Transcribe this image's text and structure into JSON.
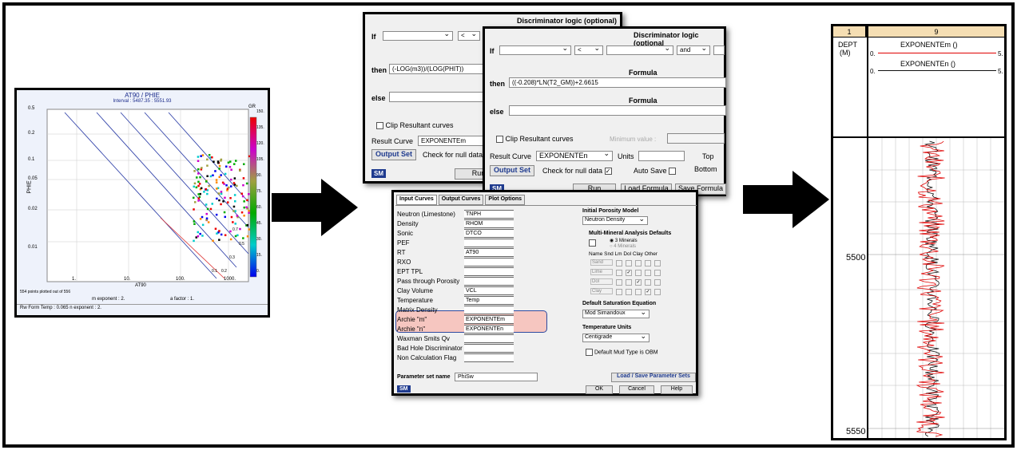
{
  "crossplot": {
    "title": "AT90 / PHIE",
    "interval": "Interval : 5487.35 : 5551.93",
    "y_label": "PHIE",
    "x_label": "AT90",
    "right_label": "GR",
    "y_ticks": [
      "0.5",
      "0.2",
      "0.1",
      "0.05",
      "0.02",
      "0.01"
    ],
    "x_ticks": [
      "1.",
      "10.",
      "100.",
      "1000."
    ],
    "color_ticks": [
      "150.",
      "135.",
      "120.",
      "105.",
      "90.",
      "75.",
      "60.",
      "45.",
      "30.",
      "15.",
      "0."
    ],
    "line_labels": [
      "0.1",
      "0.2",
      "0.3",
      "0.5",
      "0.7"
    ],
    "points_text": "554 points plotted out of 556",
    "m_exponent": "m exponent : 2.",
    "a_factor": "a factor : 1.",
    "footer": "Rw Form Temp : 0.065  n exponent : 2.",
    "chart_data": {
      "type": "scatter",
      "title": "AT90 / PHIE",
      "xlabel": "AT90",
      "ylabel": "PHIE",
      "x_scale": "log",
      "y_scale": "log",
      "xlim": [
        0.2,
        2000
      ],
      "ylim": [
        0.01,
        0.5
      ],
      "legend": "GR color scale, right"
    }
  },
  "disc1": {
    "title": "Discriminator logic (optional)",
    "if_label": "If",
    "op": "<",
    "then_label": "then",
    "then_formula": "(-LOG(m3))/(LOG(PHIT))",
    "else_label": "else",
    "clip_label": "Clip Resultant curves",
    "result_label": "Result Curve",
    "result_value": "EXPONENTEm",
    "output_set": "Output Set",
    "check_null": "Check for null data",
    "logo": "SM",
    "run": "Run"
  },
  "disc2": {
    "title": "Discriminator logic (optional",
    "if_label": "If",
    "op": "<",
    "and_label": "and",
    "formula_header": "Formula",
    "then_label": "then",
    "then_formula": "((-0.208)*LN(T2_GM))+2.6615",
    "formula_header2": "Formula",
    "else_label": "else",
    "clip_label": "Clip Resultant curves",
    "min_label": "Minimum value :",
    "result_label": "Result Curve",
    "result_value": "EXPONENTEn",
    "units_label": "Units",
    "top_label": "Top",
    "output_set": "Output Set",
    "check_null": "Check for null data",
    "auto_save": "Auto Save",
    "bottom_label": "Bottom",
    "logo": "SM",
    "run": "Run",
    "load_formula": "Load Formula",
    "save_formula": "Save Formula"
  },
  "params": {
    "tabs": [
      "Input Curves",
      "Output Curves",
      "Plot Options"
    ],
    "rows": [
      {
        "label": "Neutron (Limestone)",
        "value": "TNPH"
      },
      {
        "label": "Density",
        "value": "RHOM"
      },
      {
        "label": "Sonic",
        "value": "DTCO"
      },
      {
        "label": "PEF",
        "value": ""
      },
      {
        "label": "RT",
        "value": "AT90"
      },
      {
        "label": "RXO",
        "value": ""
      },
      {
        "label": "EPT TPL",
        "value": ""
      },
      {
        "label": "Pass through Porosity",
        "value": ""
      },
      {
        "label": "Clay Volume",
        "value": "VCL"
      },
      {
        "label": "Temperature",
        "value": "Temp"
      },
      {
        "label": "Matrix Density",
        "value": ""
      },
      {
        "label": "Archie \"m\"",
        "value": "EXPONENTEm"
      },
      {
        "label": "Archie \"n\"",
        "value": "EXPONENTEn"
      },
      {
        "label": "Waxman Smits Qv",
        "value": ""
      },
      {
        "label": "Bad Hole Discriminator",
        "value": ""
      },
      {
        "label": "Non Calculation Flag",
        "value": ""
      }
    ],
    "porosity_title": "Initial Porosity Model",
    "porosity_value": "Neutron Density",
    "mineral_title": "Multi-Mineral Analysis Defaults",
    "mineral_opt1": "3 Minerals",
    "mineral_opt2": "4 Minerals",
    "grid_header": "Name  Snd  Lm  Dol  Clay  Other",
    "grid_rows": [
      "Sand",
      "Lime",
      "Dol",
      "Clay"
    ],
    "sat_title": "Default Saturation Equation",
    "sat_value": "Mod Simandoux",
    "temp_title": "Temperature Units",
    "temp_value": "Centigrade",
    "mud_label": "Default Mud Type is OBM",
    "paramset_label": "Parameter set name",
    "paramset_value": "PhiSw",
    "load_save": "Load / Save Parameter Sets",
    "logo": "SM",
    "ok": "OK",
    "cancel": "Cancel",
    "help": "Help"
  },
  "logtrack": {
    "track1_header": "1",
    "track2_header": "9",
    "depth_label": "DEPT",
    "depth_unit": "(M)",
    "curve1": "EXPONENTEm ()",
    "curve2": "EXPONENTEn ()",
    "scale_left": "0.",
    "scale_right": "5.",
    "depth_5500": "5500",
    "depth_5550": "5550",
    "curve1_color": "#e00000",
    "curve2_color": "#111111"
  }
}
